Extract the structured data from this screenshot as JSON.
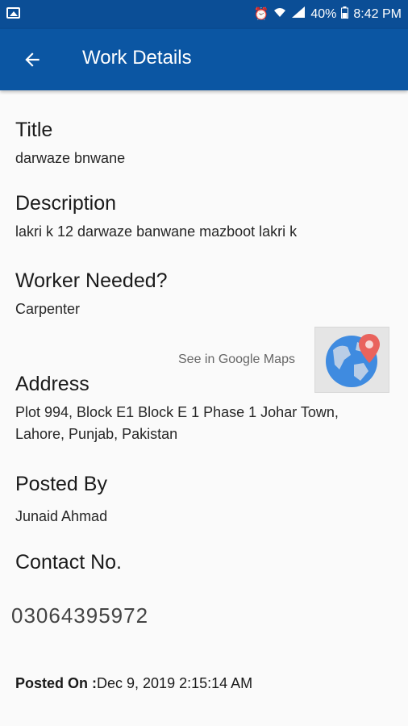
{
  "status_bar": {
    "battery": "40%",
    "time": "8:42 PM",
    "icons": [
      "image-icon",
      "alarm-icon",
      "wifi-icon",
      "signal-icon",
      "battery-icon"
    ]
  },
  "app_bar": {
    "title": "Work Details",
    "back_icon": "arrow-back-icon",
    "color": "#0b56a3"
  },
  "fields": {
    "title": {
      "label": "Title",
      "value": "darwaze bnwane"
    },
    "description": {
      "label": "Description",
      "value": "lakri k 12 darwaze banwane mazboot lakri k"
    },
    "worker": {
      "label": "Worker Needed?",
      "value": "Carpenter"
    },
    "address": {
      "label": "Address",
      "value_line1": "Plot 994, Block E1 Block E 1 Phase 1 Johar Town,",
      "value_line2": "Lahore, Punjab, Pakistan"
    },
    "posted_by": {
      "label": "Posted By",
      "value": "Junaid Ahmad"
    },
    "contact": {
      "label": "Contact No.",
      "value": "03064395972"
    }
  },
  "maps": {
    "link_text": "See in Google Maps",
    "icon": "globe-location-icon"
  },
  "posted_on": {
    "label": "Posted On :",
    "value": "Dec 9, 2019 2:15:14 AM"
  }
}
